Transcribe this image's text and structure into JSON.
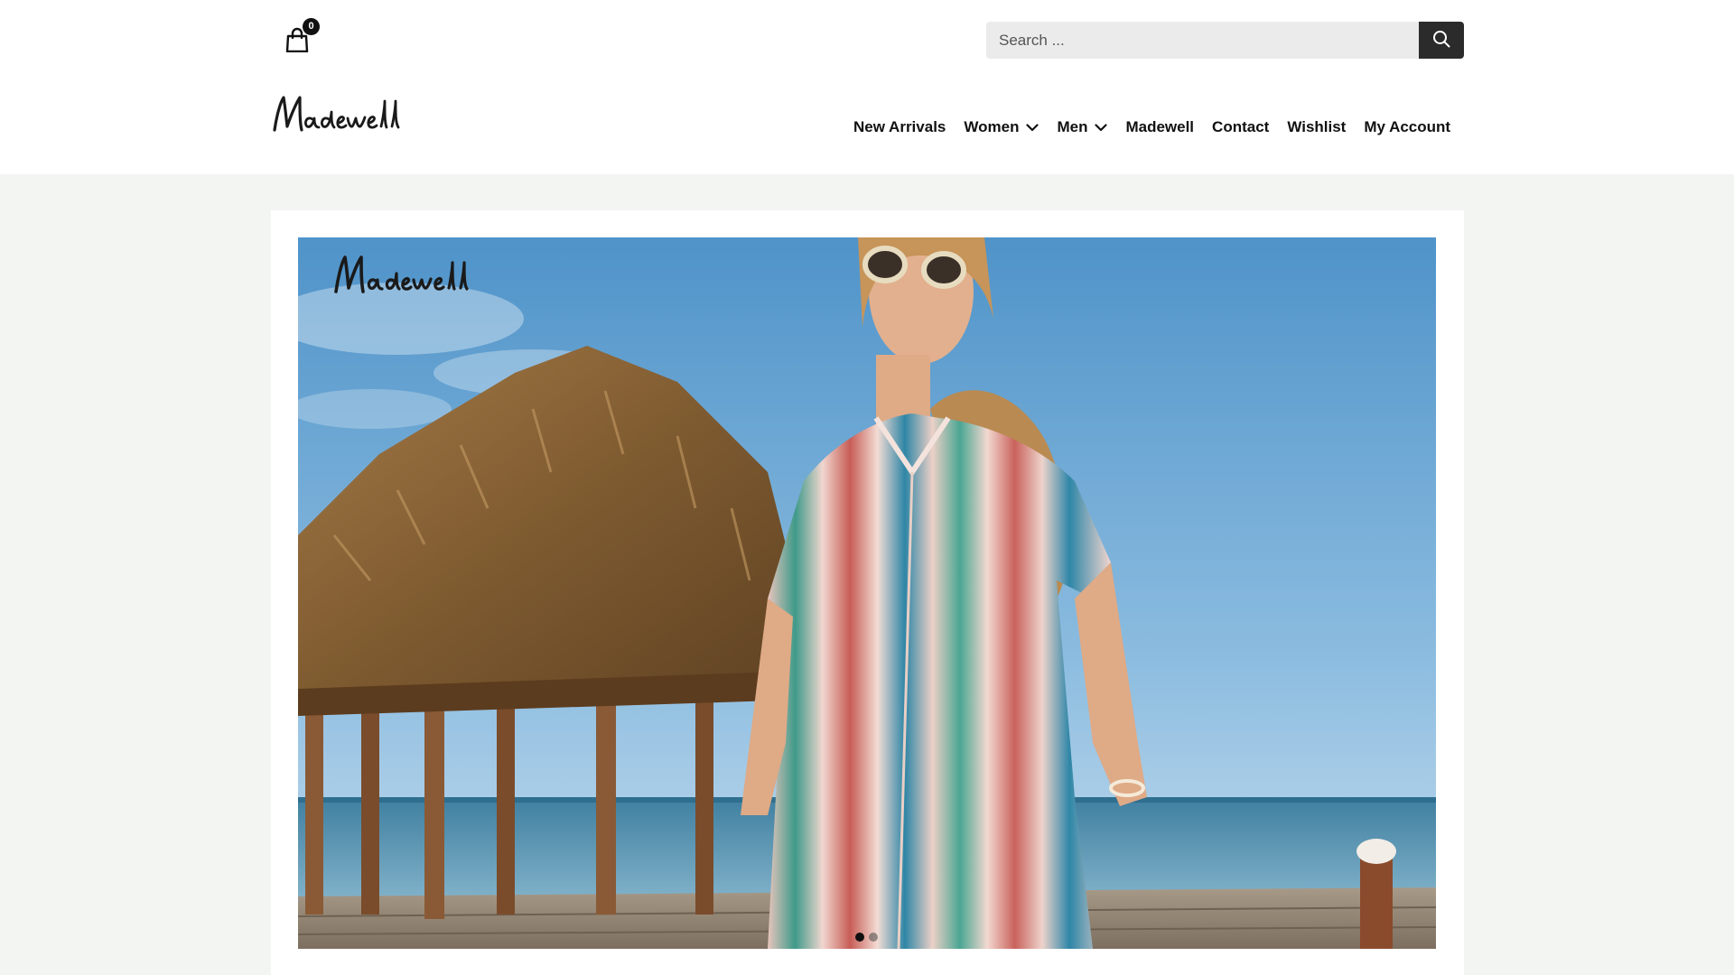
{
  "header": {
    "cart": {
      "icon": "shopping-bag-icon",
      "count": "0"
    },
    "search": {
      "placeholder": "Search ...",
      "icon": "search-icon"
    },
    "logo": {
      "text": "Madewell"
    },
    "nav": [
      {
        "label": "New Arrivals",
        "dropdown": false
      },
      {
        "label": "Women",
        "dropdown": true
      },
      {
        "label": "Men",
        "dropdown": true
      },
      {
        "label": "Madewell",
        "dropdown": false
      },
      {
        "label": "Contact",
        "dropdown": false
      },
      {
        "label": "Wishlist",
        "dropdown": false
      },
      {
        "label": "My Account",
        "dropdown": false
      }
    ]
  },
  "hero": {
    "logo_text": "Madewell",
    "slides": 2,
    "active_slide": 1
  },
  "colors": {
    "header_bg": "#ffffff",
    "page_bg": "#f3f5f2",
    "search_bg": "#ebebeb",
    "search_button": "#2b2b2b",
    "text": "#111111"
  }
}
